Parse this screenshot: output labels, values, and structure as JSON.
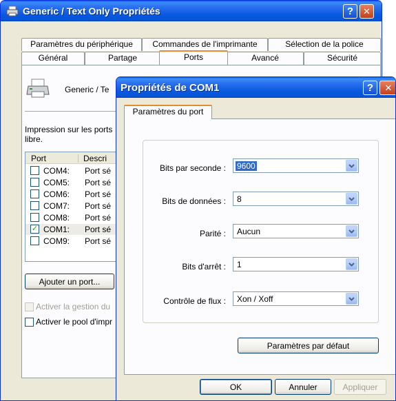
{
  "back_window": {
    "title": "Generic / Text Only Propriétés",
    "tabs_row1": [
      "Paramètres du périphérique",
      "Commandes de l'imprimante",
      "Sélection de la police"
    ],
    "tabs_row2": [
      "Général",
      "Partage",
      "Ports",
      "Avancé",
      "Sécurité"
    ],
    "active_tab": "Ports",
    "printer_name": "Generic / Te",
    "description": "Impression sur les ports",
    "description_line2": "libre.",
    "columns": [
      "Port",
      "Descri"
    ],
    "ports": [
      {
        "name": "COM4:",
        "desc": "Port sé",
        "checked": false
      },
      {
        "name": "COM5:",
        "desc": "Port sé",
        "checked": false
      },
      {
        "name": "COM6:",
        "desc": "Port sé",
        "checked": false
      },
      {
        "name": "COM7:",
        "desc": "Port sé",
        "checked": false
      },
      {
        "name": "COM8:",
        "desc": "Port sé",
        "checked": false
      },
      {
        "name": "COM1:",
        "desc": "Port sé",
        "checked": true
      },
      {
        "name": "COM9:",
        "desc": "Port sé",
        "checked": false
      }
    ],
    "add_port_button": "Ajouter un port...",
    "bidirectional_label": "Activer la gestion du",
    "pool_label": "Activer le pool d'impr"
  },
  "dialog": {
    "title": "Propriétés de COM1",
    "tab": "Paramètres du port",
    "fields": [
      {
        "label": "Bits par seconde :",
        "value": "9600",
        "selected": true
      },
      {
        "label": "Bits de données :",
        "value": "8",
        "selected": false
      },
      {
        "label": "Parité :",
        "value": "Aucun",
        "selected": false
      },
      {
        "label": "Bits d'arrêt :",
        "value": "1",
        "selected": false
      },
      {
        "label": "Contrôle de flux :",
        "value": "Xon / Xoff",
        "selected": false
      }
    ],
    "defaults_button": "Paramètres par défaut",
    "ok_button": "OK",
    "cancel_button": "Annuler",
    "apply_button": "Appliquer"
  },
  "icons": {
    "help": "?",
    "close": "✕",
    "dropdown_arrow": "chevron-down-icon",
    "window_icon": "printer-icon"
  },
  "colors": {
    "titlebar": "#0a5ee8",
    "window_bg": "#ece9d8",
    "tab_highlight": "#e68b2c",
    "selection": "#316ac5"
  }
}
